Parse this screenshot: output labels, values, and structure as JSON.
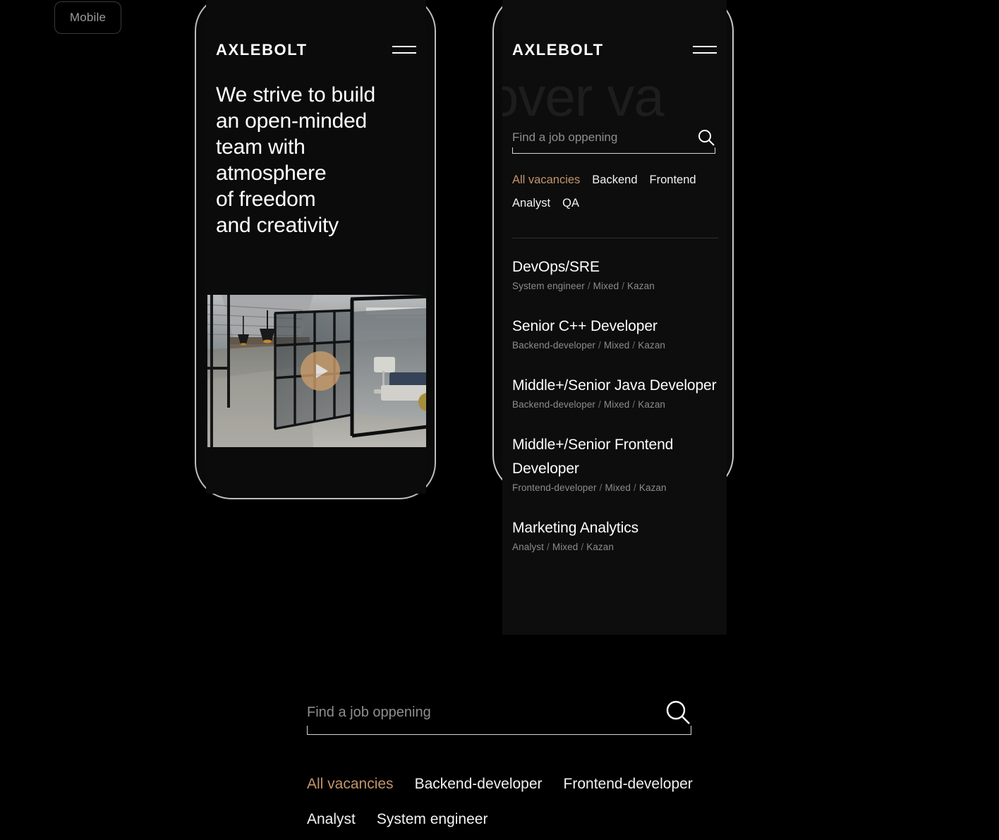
{
  "viewport_chip": {
    "label": "Mobile"
  },
  "brand": {
    "name": "AXLEBOLT"
  },
  "icons": {
    "hamburger": "hamburger-menu-icon",
    "search": "search-icon",
    "play": "play-icon"
  },
  "colors": {
    "page_background": "#000000",
    "screen_background": "#0d0d0d",
    "accent": "#c2946a",
    "text_primary": "#ffffff",
    "text_muted": "#8c8c8c",
    "frame_border": "#bdbdbd",
    "play_button": "#c89b6a",
    "ghost_text": "#1d1d1d"
  },
  "phone_left": {
    "hero_heading": "We strive to build\nan open-minded\nteam with\natmosphere\nof freedom\nand creativity",
    "video": {
      "alt": "Office corridor with glass partition walls",
      "play_label": "Play"
    }
  },
  "phone_right": {
    "ghost_text": "over va",
    "search": {
      "placeholder": "Find a job oppening",
      "value": ""
    },
    "filters": [
      {
        "label": "All vacancies",
        "active": true
      },
      {
        "label": "Backend",
        "active": false
      },
      {
        "label": "Frontend",
        "active": false
      },
      {
        "label": "Analyst",
        "active": false
      },
      {
        "label": "QA",
        "active": false
      }
    ],
    "vacancies": [
      {
        "title": "DevOps/SRE",
        "role": "System engineer",
        "type": "Mixed",
        "city": "Kazan"
      },
      {
        "title": "Senior C++ Developer",
        "role": "Backend-developer",
        "type": "Mixed",
        "city": "Kazan"
      },
      {
        "title": "Middle+/Senior Java Developer",
        "role": "Backend-developer",
        "type": "Mixed",
        "city": "Kazan"
      },
      {
        "title": "Middle+/Senior Frontend Developer",
        "role": "Frontend-developer",
        "type": "Mixed",
        "city": "Kazan"
      },
      {
        "title": "Marketing Analytics",
        "role": "Analyst",
        "type": "Mixed",
        "city": "Kazan"
      }
    ]
  },
  "desktop_section": {
    "search": {
      "placeholder": "Find a job oppening",
      "value": ""
    },
    "filters": [
      {
        "label": "All vacancies",
        "active": true
      },
      {
        "label": "Backend-developer",
        "active": false
      },
      {
        "label": "Frontend-developer",
        "active": false
      },
      {
        "label": "Analyst",
        "active": false
      },
      {
        "label": "System engineer",
        "active": false
      }
    ]
  },
  "separator": "/"
}
